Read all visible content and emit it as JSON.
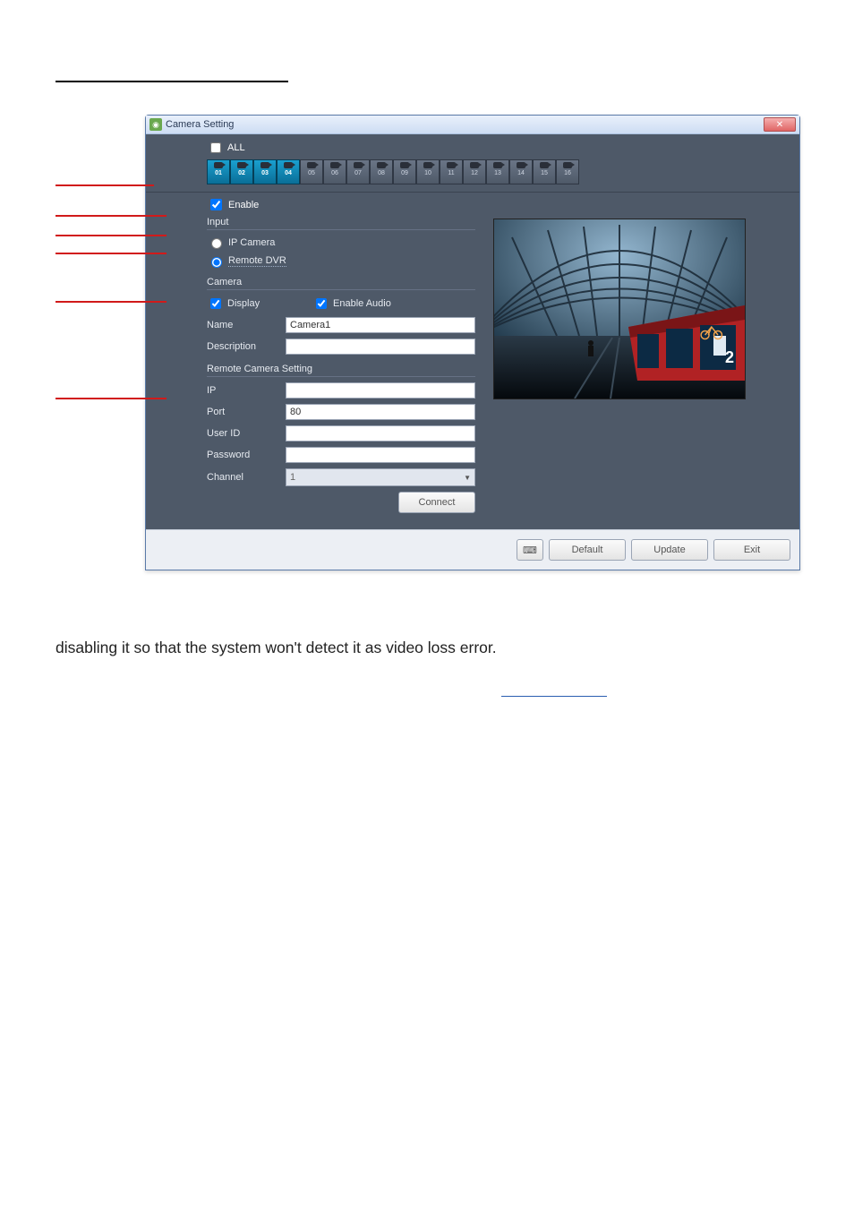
{
  "window": {
    "title": "Camera Setting",
    "topstrip": {
      "all_label": "ALL",
      "cameras": [
        {
          "num": "01",
          "active": true
        },
        {
          "num": "02",
          "active": true
        },
        {
          "num": "03",
          "active": true
        },
        {
          "num": "04",
          "active": true
        },
        {
          "num": "05",
          "active": false
        },
        {
          "num": "06",
          "active": false
        },
        {
          "num": "07",
          "active": false
        },
        {
          "num": "08",
          "active": false
        },
        {
          "num": "09",
          "active": false
        },
        {
          "num": "10",
          "active": false
        },
        {
          "num": "11",
          "active": false
        },
        {
          "num": "12",
          "active": false
        },
        {
          "num": "13",
          "active": false
        },
        {
          "num": "14",
          "active": false
        },
        {
          "num": "15",
          "active": false
        },
        {
          "num": "16",
          "active": false
        }
      ]
    },
    "enable_label": "Enable",
    "input": {
      "title": "Input",
      "opt_ip": "IP Camera",
      "opt_remote": "Remote DVR"
    },
    "camera": {
      "title": "Camera",
      "display_label": "Display",
      "enable_audio_label": "Enable Audio",
      "name_label": "Name",
      "name_value": "Camera1",
      "description_label": "Description",
      "description_value": ""
    },
    "remote": {
      "title": "Remote Camera Setting",
      "ip_label": "IP",
      "ip_value": "",
      "port_label": "Port",
      "port_value": "80",
      "user_label": "User ID",
      "user_value": "",
      "pwd_label": "Password",
      "pwd_value": "",
      "channel_label": "Channel",
      "channel_value": "1",
      "connect_label": "Connect"
    },
    "footer": {
      "default_label": "Default",
      "update_label": "Update",
      "exit_label": "Exit"
    }
  },
  "body_line": "disabling it so that the system won't detect it as video loss error."
}
